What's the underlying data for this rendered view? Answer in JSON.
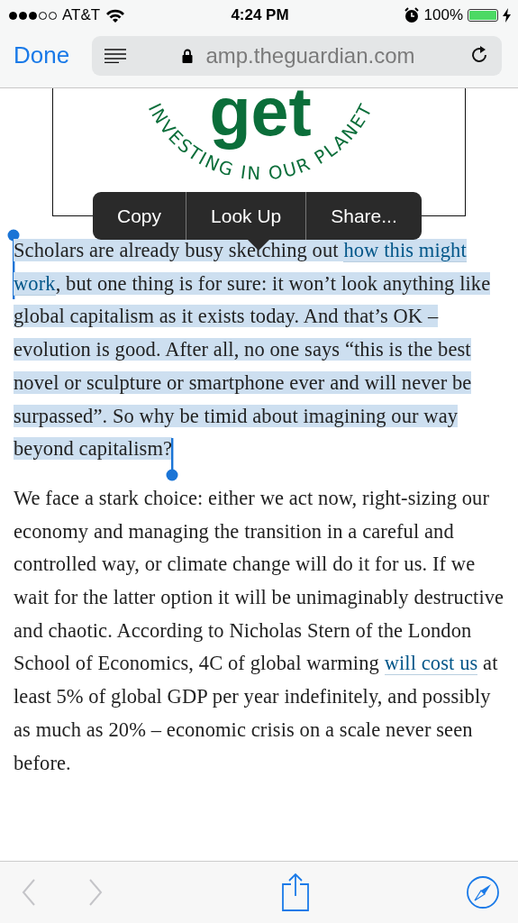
{
  "status_bar": {
    "signal_bars": [
      {
        "on": true
      },
      {
        "on": true
      },
      {
        "on": true
      },
      {
        "on": false
      },
      {
        "on": false
      }
    ],
    "carrier": "AT&T",
    "time": "4:24 PM",
    "battery_text": "100%",
    "battery": {
      "level": 1.0
    }
  },
  "nav_bar": {
    "done": "Done",
    "address": "amp.theguardian.com"
  },
  "article": {
    "image": {
      "logo_word": "get",
      "logo_arc": "INVESTING IN OUR PLANET"
    },
    "edit_menu": [
      {
        "label": "Copy"
      },
      {
        "label": "Look Up"
      },
      {
        "label": "Share..."
      }
    ],
    "paragraphs": [
      {
        "selected": true,
        "segments": [
          {
            "text": "Scholars are already busy sketching out ",
            "link": false
          },
          {
            "text": "how this might work",
            "link": true
          },
          {
            "text": ", but one thing is for sure: it won’t look anything like global capitalism as it exists today. And that’s OK – evolution is good. After all, no one says “this is the best novel or sculpture or smartphone ever and will never be surpassed”. So why be timid about imagining our way beyond capitalism?",
            "link": false
          }
        ]
      },
      {
        "selected": false,
        "segments": [
          {
            "text": "We face a stark choice: either we act now, right-sizing our economy and managing the transition in a careful and controlled way, or climate change will do it for us. If we wait for the latter option it will be unimaginably destructive and chaotic. According to Nicholas Stern of the London School of Economics, 4C of global warming ",
            "link": false
          },
          {
            "text": "will cost us",
            "link": true
          },
          {
            "text": " at least 5% of global GDP per year indefinitely, and possibly as much as 20% – economic crisis on a scale never seen before.",
            "link": false
          }
        ]
      }
    ]
  },
  "toolbar": {
    "back": {
      "disabled": true
    },
    "forward": {
      "disabled": true
    }
  }
}
